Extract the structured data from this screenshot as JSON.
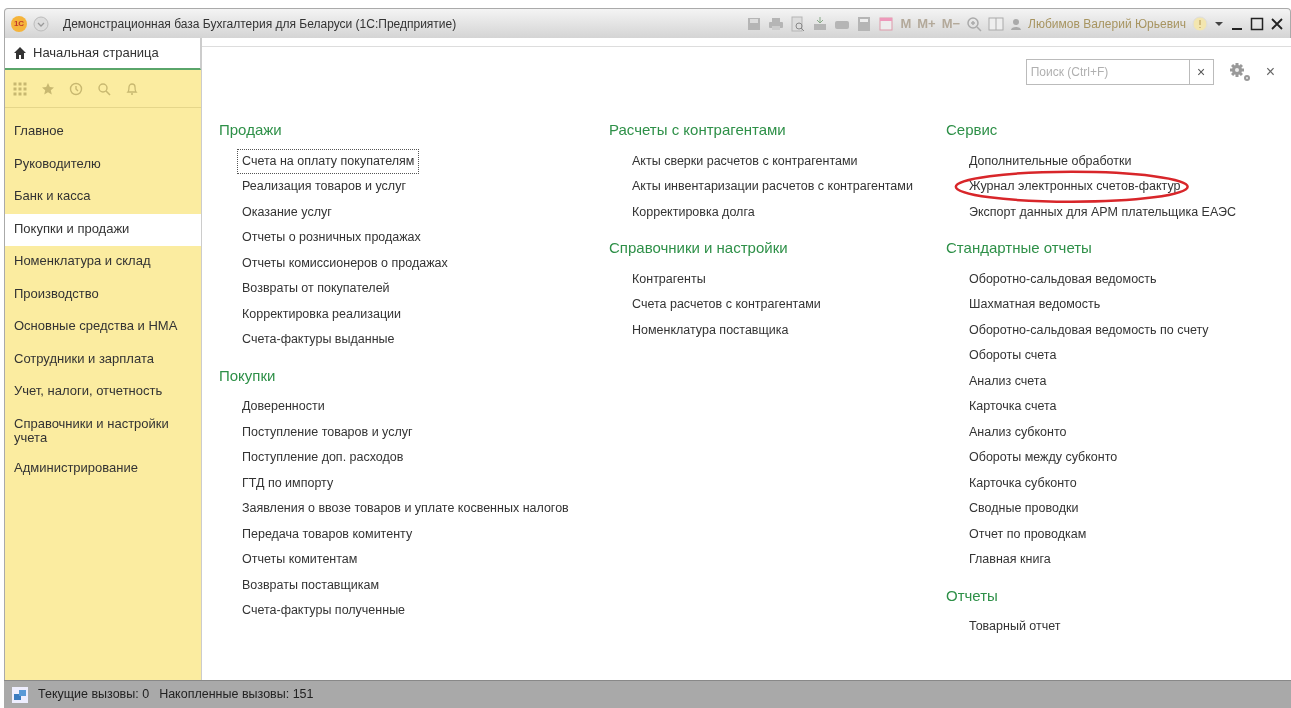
{
  "window": {
    "title": "Демонстрационная база Бухгалтерия для Беларуси  (1С:Предприятие)",
    "logo": "1С",
    "memory_buttons": [
      "M",
      "M+",
      "M−"
    ],
    "user": "Любимов Валерий Юрьевич"
  },
  "home_tab": {
    "label": "Начальная страница",
    "selected": true
  },
  "sidebar": {
    "items": [
      {
        "label": "Главное",
        "selected": false
      },
      {
        "label": "Руководителю",
        "selected": false
      },
      {
        "label": "Банк и касса",
        "selected": false
      },
      {
        "label": "Покупки и продажи",
        "selected": true
      },
      {
        "label": "Номенклатура и склад",
        "selected": false
      },
      {
        "label": "Производство",
        "selected": false
      },
      {
        "label": "Основные средства и НМА",
        "selected": false
      },
      {
        "label": "Сотрудники и зарплата",
        "selected": false
      },
      {
        "label": "Учет, налоги, отчетность",
        "selected": false
      },
      {
        "label": "Справочники и настройки учета",
        "selected": false
      },
      {
        "label": "Администрирование",
        "selected": false
      }
    ]
  },
  "search": {
    "placeholder": "Поиск (Ctrl+F)",
    "clear": "×"
  },
  "close": "×",
  "columns": [
    [
      {
        "title": "Продажи",
        "items": [
          {
            "label": "Счета на оплату покупателям",
            "focused": true,
            "highlighted": false
          },
          {
            "label": "Реализация товаров и услуг",
            "focused": false,
            "highlighted": false
          },
          {
            "label": "Оказание услуг",
            "focused": false,
            "highlighted": false
          },
          {
            "label": "Отчеты о розничных продажах",
            "focused": false,
            "highlighted": false
          },
          {
            "label": "Отчеты комиссионеров о продажах",
            "focused": false,
            "highlighted": false
          },
          {
            "label": "Возвраты от покупателей",
            "focused": false,
            "highlighted": false
          },
          {
            "label": "Корректировка реализации",
            "focused": false,
            "highlighted": false
          },
          {
            "label": "Счета-фактуры выданные",
            "focused": false,
            "highlighted": false
          }
        ]
      },
      {
        "title": "Покупки",
        "items": [
          {
            "label": "Доверенности",
            "focused": false,
            "highlighted": false
          },
          {
            "label": "Поступление товаров и услуг",
            "focused": false,
            "highlighted": false
          },
          {
            "label": "Поступление доп. расходов",
            "focused": false,
            "highlighted": false
          },
          {
            "label": "ГТД по импорту",
            "focused": false,
            "highlighted": false
          },
          {
            "label": "Заявления о ввозе товаров и уплате косвенных налогов",
            "focused": false,
            "highlighted": false
          },
          {
            "label": "Передача товаров комитенту",
            "focused": false,
            "highlighted": false
          },
          {
            "label": "Отчеты комитентам",
            "focused": false,
            "highlighted": false
          },
          {
            "label": "Возвраты поставщикам",
            "focused": false,
            "highlighted": false
          },
          {
            "label": "Счета-фактуры полученные",
            "focused": false,
            "highlighted": false
          }
        ]
      }
    ],
    [
      {
        "title": "Расчеты с контрагентами",
        "items": [
          {
            "label": "Акты сверки расчетов с контрагентами",
            "focused": false,
            "highlighted": false
          },
          {
            "label": "Акты инвентаризации расчетов с контрагентами",
            "focused": false,
            "highlighted": false
          },
          {
            "label": "Корректировка долга",
            "focused": false,
            "highlighted": false
          }
        ]
      },
      {
        "title": "Справочники и настройки",
        "items": [
          {
            "label": "Контрагенты",
            "focused": false,
            "highlighted": false
          },
          {
            "label": "Счета расчетов с контрагентами",
            "focused": false,
            "highlighted": false
          },
          {
            "label": "Номенклатура поставщика",
            "focused": false,
            "highlighted": false
          }
        ]
      }
    ],
    [
      {
        "title": "Сервис",
        "items": [
          {
            "label": "Дополнительные обработки",
            "focused": false,
            "highlighted": false
          },
          {
            "label": "Журнал электронных счетов-фактур",
            "focused": false,
            "highlighted": true
          },
          {
            "label": "Экспорт данных для АРМ плательщика ЕАЭС",
            "focused": false,
            "highlighted": false
          }
        ]
      },
      {
        "title": "Стандартные отчеты",
        "items": [
          {
            "label": "Оборотно-сальдовая ведомость",
            "focused": false,
            "highlighted": false
          },
          {
            "label": "Шахматная ведомость",
            "focused": false,
            "highlighted": false
          },
          {
            "label": "Оборотно-сальдовая ведомость по счету",
            "focused": false,
            "highlighted": false
          },
          {
            "label": "Обороты счета",
            "focused": false,
            "highlighted": false
          },
          {
            "label": "Анализ счета",
            "focused": false,
            "highlighted": false
          },
          {
            "label": "Карточка счета",
            "focused": false,
            "highlighted": false
          },
          {
            "label": "Анализ субконто",
            "focused": false,
            "highlighted": false
          },
          {
            "label": "Обороты между субконто",
            "focused": false,
            "highlighted": false
          },
          {
            "label": "Карточка субконто",
            "focused": false,
            "highlighted": false
          },
          {
            "label": "Сводные проводки",
            "focused": false,
            "highlighted": false
          },
          {
            "label": "Отчет по проводкам",
            "focused": false,
            "highlighted": false
          },
          {
            "label": "Главная книга",
            "focused": false,
            "highlighted": false
          }
        ]
      },
      {
        "title": "Отчеты",
        "items": [
          {
            "label": "Товарный отчет",
            "focused": false,
            "highlighted": false
          }
        ]
      }
    ]
  ],
  "status_bar": [
    "Текущие вызовы: 0",
    "Накопленные вызовы: 151"
  ]
}
